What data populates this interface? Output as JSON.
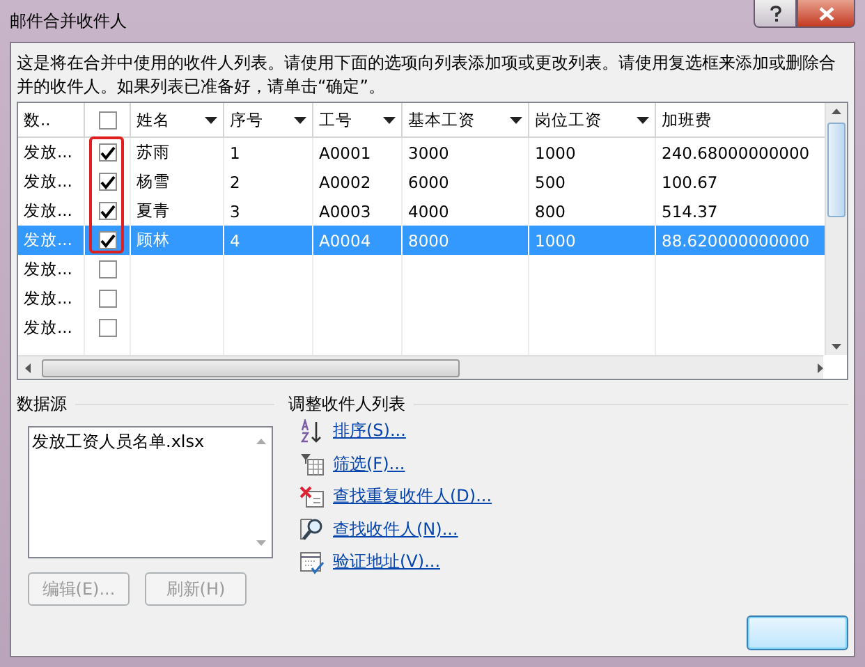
{
  "window": {
    "title": "邮件合并收件人"
  },
  "intro": "这是将在合并中使用的收件人列表。请使用下面的选项向列表添加项或更改列表。请使用复选框来添加或删除合并的收件人。如果列表已准备好，请单击“确定”。",
  "table": {
    "columns": [
      {
        "label": "数..",
        "dropdown": false
      },
      {
        "kind": "checkbox",
        "checked": false
      },
      {
        "label": "姓名",
        "dropdown": true
      },
      {
        "label": "序号",
        "dropdown": true
      },
      {
        "label": "工号",
        "dropdown": true
      },
      {
        "label": "基本工资",
        "dropdown": true
      },
      {
        "label": "岗位工资",
        "dropdown": true
      },
      {
        "label": "加班费",
        "dropdown": false
      }
    ],
    "rows": [
      {
        "source": "发放...",
        "checked": true,
        "selected": false,
        "cells": [
          "苏雨",
          "1",
          "A0001",
          "3000",
          "1000",
          "240.68000000000"
        ]
      },
      {
        "source": "发放...",
        "checked": true,
        "selected": false,
        "cells": [
          "杨雪",
          "2",
          "A0002",
          "6000",
          "500",
          "100.67"
        ]
      },
      {
        "source": "发放...",
        "checked": true,
        "selected": false,
        "cells": [
          "夏青",
          "3",
          "A0003",
          "4000",
          "800",
          "514.37"
        ]
      },
      {
        "source": "发放...",
        "checked": true,
        "selected": true,
        "cells": [
          "顾林",
          "4",
          "A0004",
          "8000",
          "1000",
          "88.620000000000"
        ]
      },
      {
        "source": "发放...",
        "checked": false,
        "selected": false
      },
      {
        "source": "发放...",
        "checked": false,
        "selected": false
      },
      {
        "source": "发放...",
        "checked": false,
        "selected": false
      }
    ]
  },
  "data_source": {
    "label": "数据源",
    "items": [
      "发放工资人员名单.xlsx"
    ],
    "buttons": [
      {
        "label": "编辑(E)...",
        "disabled": true
      },
      {
        "label": "刷新(H)",
        "disabled": true
      }
    ]
  },
  "refine": {
    "label": "调整收件人列表",
    "links": [
      {
        "label": "排序(S)...",
        "kind": "sort"
      },
      {
        "label": "筛选(F)...",
        "kind": "filter"
      },
      {
        "label": "查找重复收件人(D)...",
        "kind": "duplicates"
      },
      {
        "label": "查找收件人(N)...",
        "kind": "find"
      },
      {
        "label": "验证地址(V)...",
        "kind": "validate"
      }
    ]
  }
}
